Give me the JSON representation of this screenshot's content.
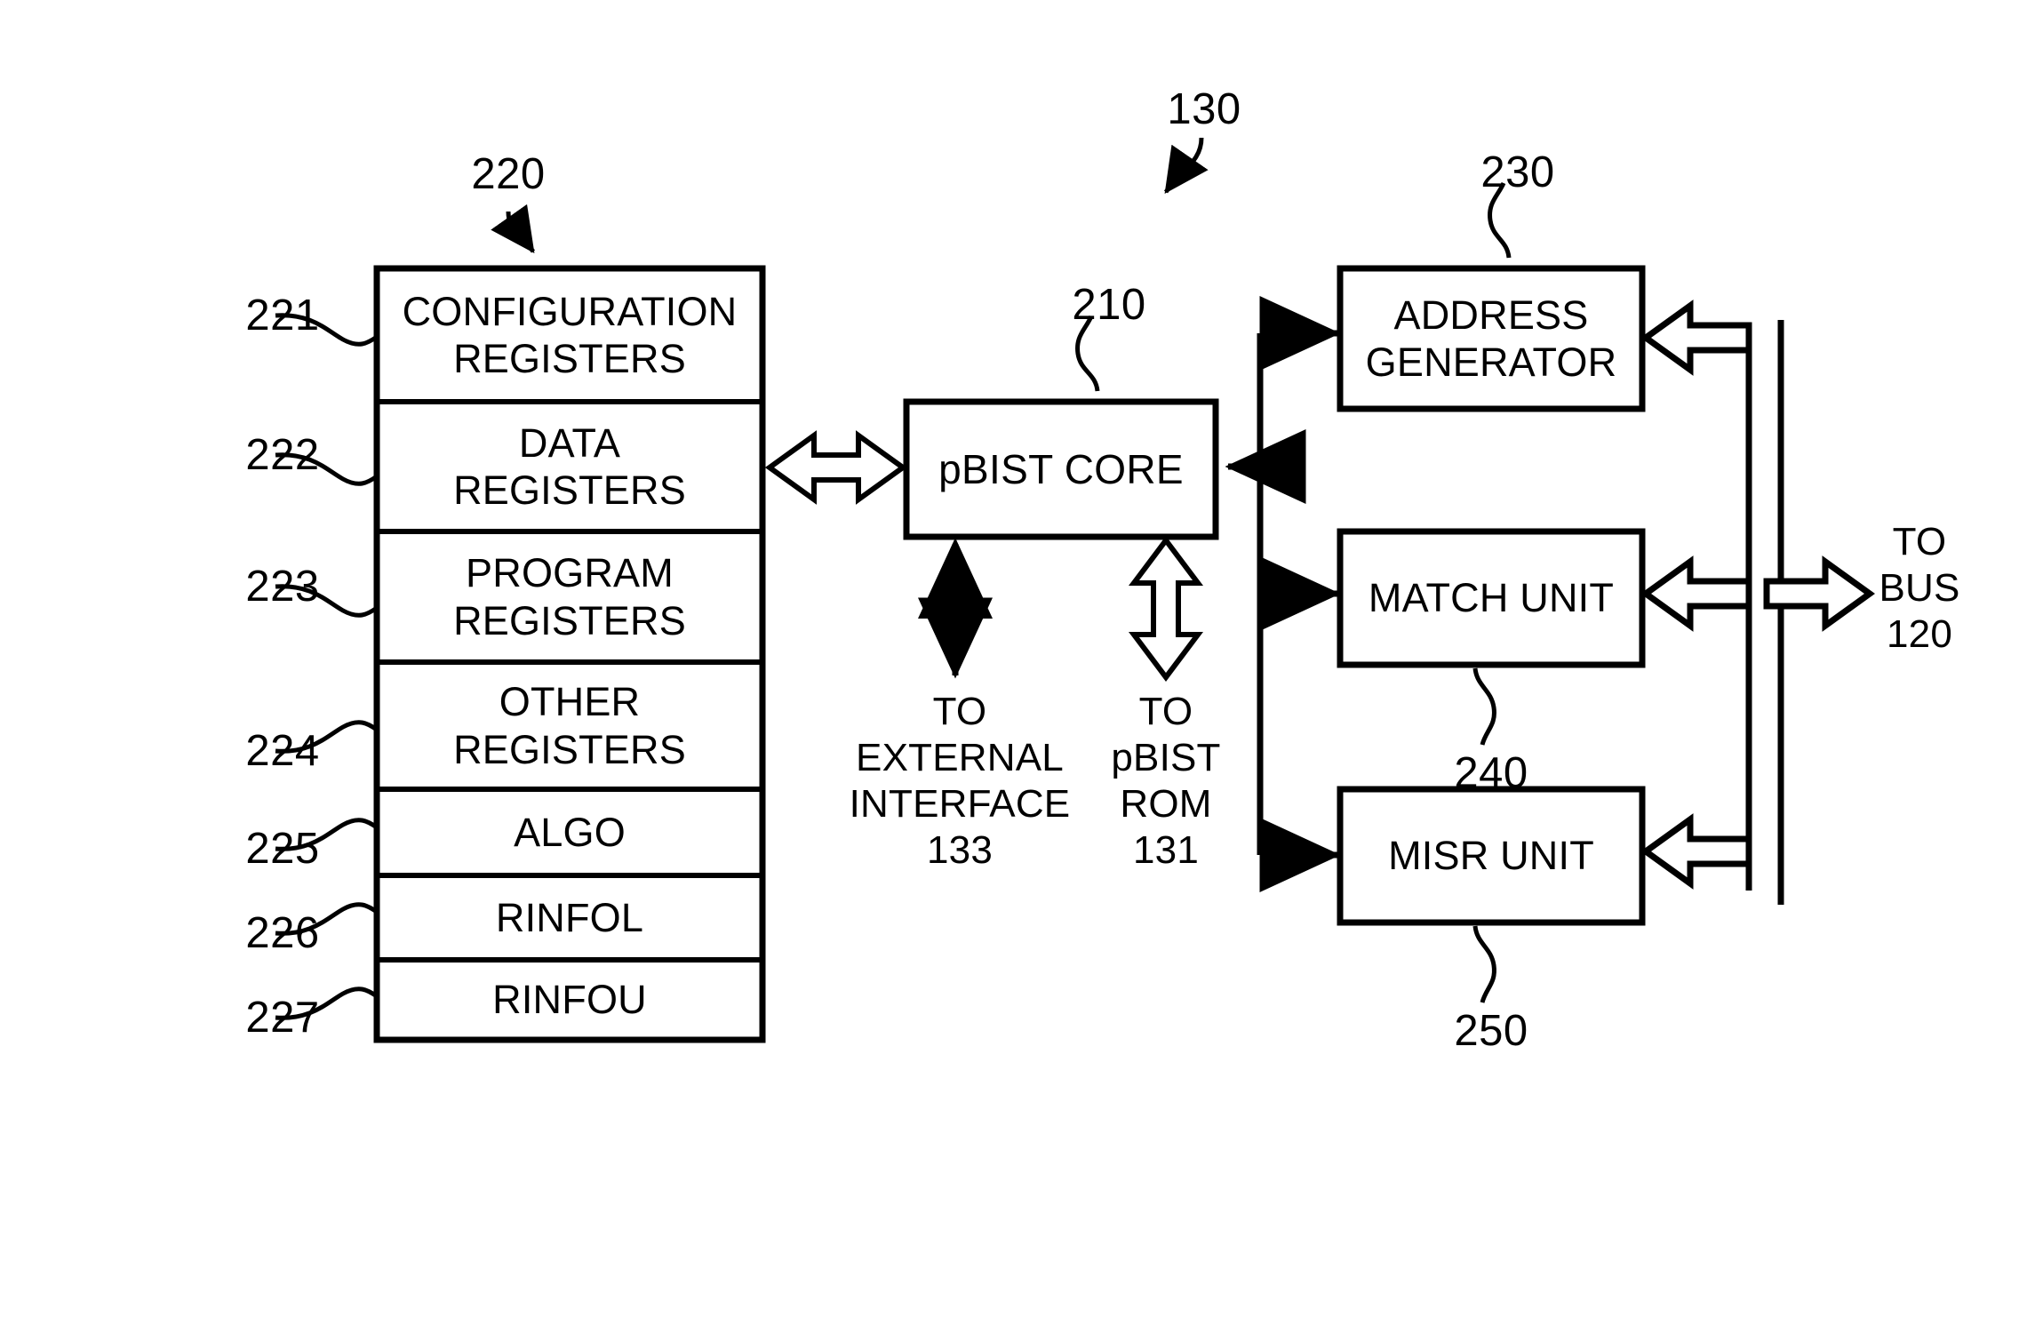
{
  "figure": {
    "system_ref": "130",
    "register_block": {
      "ref": "220",
      "rows": [
        {
          "ref": "221",
          "label": "CONFIGURATION\nREGISTERS"
        },
        {
          "ref": "222",
          "label": "DATA\nREGISTERS"
        },
        {
          "ref": "223",
          "label": "PROGRAM\nREGISTERS"
        },
        {
          "ref": "224",
          "label": "OTHER\nREGISTERS"
        },
        {
          "ref": "225",
          "label": "ALGO"
        },
        {
          "ref": "226",
          "label": "RINFOL"
        },
        {
          "ref": "227",
          "label": "RINFOU"
        }
      ]
    },
    "core": {
      "ref": "210",
      "label": "pBIST CORE"
    },
    "units": [
      {
        "ref": "230",
        "label": "ADDRESS\nGENERATOR"
      },
      {
        "ref": "240",
        "label": "MATCH UNIT"
      },
      {
        "ref": "250",
        "label": "MISR UNIT"
      }
    ],
    "annotations": [
      {
        "name": "external-interface",
        "label": "TO\nEXTERNAL\nINTERFACE\n133"
      },
      {
        "name": "pbist-rom",
        "label": "TO\npBIST\nROM\n131"
      },
      {
        "name": "bus",
        "label": "TO\nBUS\n120"
      }
    ],
    "colors": {
      "stroke": "#000000",
      "background": "#ffffff"
    }
  }
}
